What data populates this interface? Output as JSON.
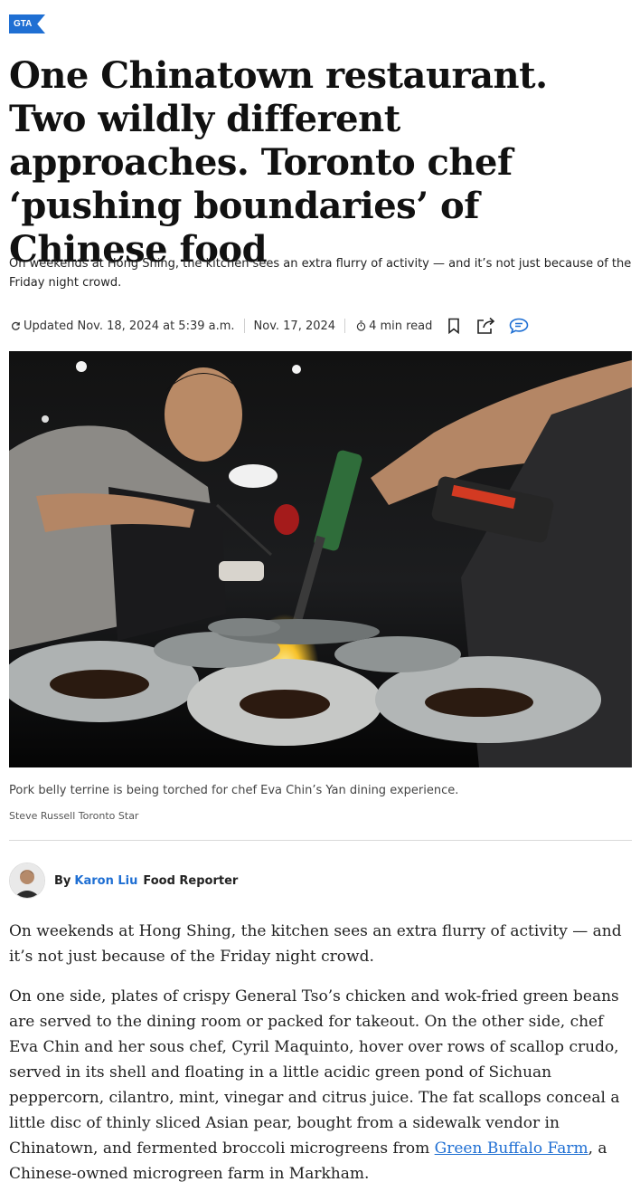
{
  "section_tag": "GTA",
  "headline": "One Chinatown restaurant. Two wildly different approaches. Toronto chef ‘pushing boundaries’ of Chinese food",
  "dek": "On weekends at Hong Shing, the kitchen sees an extra flurry of activity — and it’s not just because of the Friday night crowd.",
  "meta": {
    "updated": "Updated Nov. 18, 2024 at 5:39 a.m.",
    "published": "Nov. 17, 2024",
    "read_time": "4 min read",
    "icons": [
      "refresh-icon",
      "timer-icon",
      "bookmark-icon",
      "share-icon",
      "comment-icon"
    ]
  },
  "photo": {
    "caption": "Pork belly terrine is being torched for chef Eva Chin’s Yan dining experience.",
    "credit": "Steve Russell Toronto Star"
  },
  "byline": {
    "by": "By",
    "author": "Karon Liu",
    "role": "Food Reporter"
  },
  "body": {
    "p1": "On weekends at Hong Shing, the kitchen sees an extra flurry of activity — and it’s not just because of the Friday night crowd.",
    "p2_before": "On one side, plates of crispy General Tso’s chicken and wok-fried green beans are served to the dining room or packed for takeout. On the other side, chef Eva Chin and her sous chef, Cyril Maquinto, hover over rows of scallop crudo, served in its shell and floating in a little acidic green pond of Sichuan peppercorn, cilantro, mint, vinegar and citrus juice. The fat scallops conceal a little disc of thinly sliced Asian pear, bought from a sidewalk vendor in Chinatown, and fermented broccoli microgreens from ",
    "p2_link": "Green Buffalo Farm",
    "p2_after": ", a Chinese-owned microgreen farm in Markham."
  },
  "colors": {
    "accent": "#1f6fd3",
    "text": "#111111",
    "muted": "#444444"
  }
}
